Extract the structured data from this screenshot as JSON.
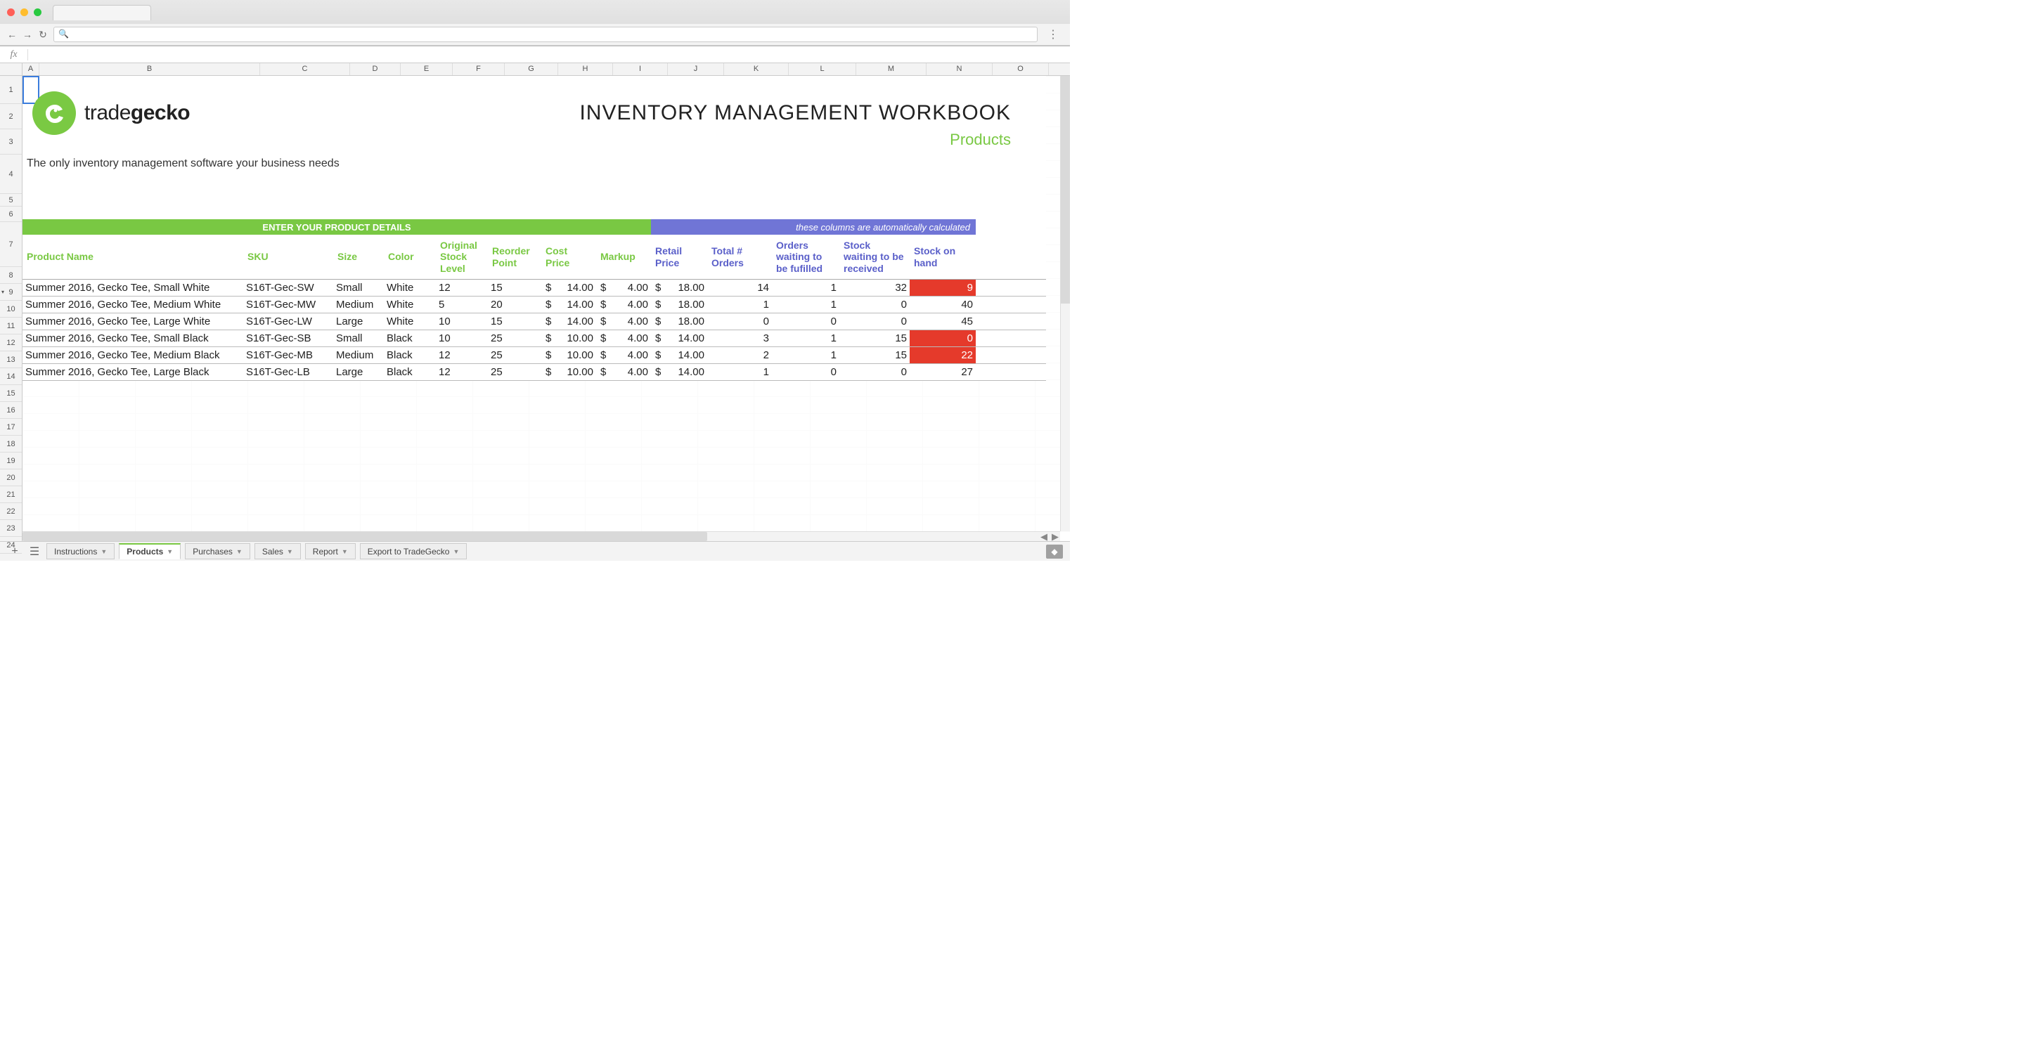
{
  "window": {
    "title": "INVENTORY MANAGEMENT  WORKBOOK",
    "subtitle": "Products",
    "tagline": "The only inventory management software your business needs",
    "brand_light": "trade",
    "brand_bold": "gecko"
  },
  "formula_bar": {
    "fx": "fx",
    "value": ""
  },
  "columns": [
    "A",
    "B",
    "C",
    "D",
    "E",
    "F",
    "G",
    "H",
    "I",
    "J",
    "K",
    "L",
    "M",
    "N",
    "O"
  ],
  "row_numbers": [
    1,
    2,
    3,
    4,
    5,
    6,
    7,
    8,
    9,
    10,
    11,
    12,
    13,
    14,
    15,
    16,
    17,
    18,
    19,
    20,
    21,
    22,
    23,
    24
  ],
  "row_heights": {
    "1": 40,
    "2": 36,
    "3": 36,
    "4": 56,
    "5": 18,
    "6": 22,
    "7": 64,
    "default": 24
  },
  "banner": {
    "green": "ENTER YOUR PRODUCT DETAILS",
    "blue": "these  columns are automatically calculated"
  },
  "headers": {
    "green": [
      "Product Name",
      "SKU",
      "Size",
      "Color",
      "Original Stock Level",
      "Reorder Point",
      "Cost Price",
      "Markup"
    ],
    "blue": [
      "Retail Price",
      "Total # Orders",
      "Orders waiting to be fufilled",
      "Stock waiting to be received",
      "Stock on hand"
    ]
  },
  "currency": "$",
  "rows": [
    {
      "name": "Summer 2016, Gecko Tee, Small White",
      "sku": "S16T-Gec-SW",
      "size": "Small",
      "color": "White",
      "orig": "12",
      "reorder": "15",
      "cost": "14.00",
      "markup": "4.00",
      "retail": "18.00",
      "orders": "14",
      "waiting_fulfil": "1",
      "waiting_recv": "32",
      "on_hand": "9",
      "alert": true
    },
    {
      "name": "Summer 2016, Gecko Tee, Medium White",
      "sku": "S16T-Gec-MW",
      "size": "Medium",
      "color": "White",
      "orig": "5",
      "reorder": "20",
      "cost": "14.00",
      "markup": "4.00",
      "retail": "18.00",
      "orders": "1",
      "waiting_fulfil": "1",
      "waiting_recv": "0",
      "on_hand": "40",
      "alert": false
    },
    {
      "name": "Summer 2016, Gecko Tee, Large White",
      "sku": "S16T-Gec-LW",
      "size": "Large",
      "color": "White",
      "orig": "10",
      "reorder": "15",
      "cost": "14.00",
      "markup": "4.00",
      "retail": "18.00",
      "orders": "0",
      "waiting_fulfil": "0",
      "waiting_recv": "0",
      "on_hand": "45",
      "alert": false
    },
    {
      "name": "Summer 2016, Gecko Tee, Small Black",
      "sku": "S16T-Gec-SB",
      "size": "Small",
      "color": "Black",
      "orig": "10",
      "reorder": "25",
      "cost": "10.00",
      "markup": "4.00",
      "retail": "14.00",
      "orders": "3",
      "waiting_fulfil": "1",
      "waiting_recv": "15",
      "on_hand": "0",
      "alert": true
    },
    {
      "name": "Summer 2016, Gecko Tee, Medium Black",
      "sku": "S16T-Gec-MB",
      "size": "Medium",
      "color": "Black",
      "orig": "12",
      "reorder": "25",
      "cost": "10.00",
      "markup": "4.00",
      "retail": "14.00",
      "orders": "2",
      "waiting_fulfil": "1",
      "waiting_recv": "15",
      "on_hand": "22",
      "alert": true
    },
    {
      "name": "Summer 2016, Gecko Tee, Large Black",
      "sku": "S16T-Gec-LB",
      "size": "Large",
      "color": "Black",
      "orig": "12",
      "reorder": "25",
      "cost": "10.00",
      "markup": "4.00",
      "retail": "14.00",
      "orders": "1",
      "waiting_fulfil": "0",
      "waiting_recv": "0",
      "on_hand": "27",
      "alert": false
    }
  ],
  "tabs": [
    {
      "label": "Instructions",
      "active": false
    },
    {
      "label": "Products",
      "active": true
    },
    {
      "label": "Purchases",
      "active": false
    },
    {
      "label": "Sales",
      "active": false
    },
    {
      "label": "Report",
      "active": false
    },
    {
      "label": "Export to TradeGecko",
      "active": false
    }
  ],
  "col_widths": {
    "A": 24,
    "B": 314,
    "C": 128,
    "D": 72,
    "E": 74,
    "F": 74,
    "G": 76,
    "H": 78,
    "I": 78,
    "J": 80,
    "K": 92,
    "L": 96,
    "M": 100,
    "N": 94,
    "O": 80
  }
}
